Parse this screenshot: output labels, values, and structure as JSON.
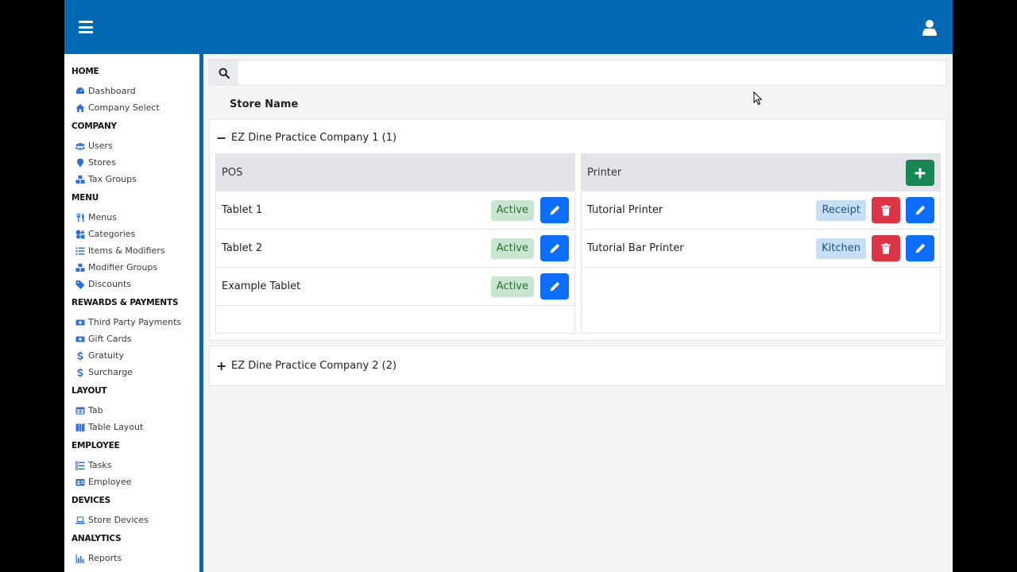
{
  "sidebar": {
    "sections": [
      {
        "title": "HOME",
        "items": [
          {
            "label": "Dashboard",
            "icon": "dashboard-icon"
          },
          {
            "label": "Company Select",
            "icon": "home-icon"
          }
        ]
      },
      {
        "title": "COMPANY",
        "items": [
          {
            "label": "Users",
            "icon": "users-icon"
          },
          {
            "label": "Stores",
            "icon": "map-pin-icon"
          },
          {
            "label": "Tax Groups",
            "icon": "cubes-icon"
          }
        ]
      },
      {
        "title": "MENU",
        "items": [
          {
            "label": "Menus",
            "icon": "utensils-icon"
          },
          {
            "label": "Categories",
            "icon": "shapes-icon"
          },
          {
            "label": "Items & Modifiers",
            "icon": "list-icon"
          },
          {
            "label": "Modifier Groups",
            "icon": "cubes-icon"
          },
          {
            "label": "Discounts",
            "icon": "tags-icon"
          }
        ]
      },
      {
        "title": "REWARDS & PAYMENTS",
        "items": [
          {
            "label": "Third Party Payments",
            "icon": "money-bill-icon"
          },
          {
            "label": "Gift Cards",
            "icon": "money-bill-icon"
          },
          {
            "label": "Gratuity",
            "icon": "dollar-icon"
          },
          {
            "label": "Surcharge",
            "icon": "dollar-icon"
          }
        ]
      },
      {
        "title": "LAYOUT",
        "items": [
          {
            "label": "Tab",
            "icon": "table-icon"
          },
          {
            "label": "Table Layout",
            "icon": "map-icon"
          }
        ]
      },
      {
        "title": "EMPLOYEE",
        "items": [
          {
            "label": "Tasks",
            "icon": "tasks-icon"
          },
          {
            "label": "Employee",
            "icon": "id-card-icon"
          }
        ]
      },
      {
        "title": "DEVICES",
        "items": [
          {
            "label": "Store Devices",
            "icon": "laptop-icon"
          }
        ]
      },
      {
        "title": "ANALYTICS",
        "items": [
          {
            "label": "Reports",
            "icon": "chart-icon"
          }
        ]
      }
    ]
  },
  "search": {
    "placeholder": "",
    "value": ""
  },
  "table": {
    "column_header": "Store Name"
  },
  "companies": [
    {
      "name": "EZ Dine Practice Company 1 (1)",
      "expanded": true,
      "toggle": "−"
    },
    {
      "name": "EZ Dine Practice Company 2 (2)",
      "expanded": false,
      "toggle": "+"
    }
  ],
  "pos_panel": {
    "title": "POS",
    "rows": [
      {
        "label": "Tablet 1",
        "status": "Active"
      },
      {
        "label": "Tablet 2",
        "status": "Active"
      },
      {
        "label": "Example Tablet",
        "status": "Active"
      }
    ]
  },
  "printer_panel": {
    "title": "Printer",
    "rows": [
      {
        "label": "Tutorial Printer",
        "type": "Receipt"
      },
      {
        "label": "Tutorial Bar Printer",
        "type": "Kitchen"
      }
    ]
  },
  "colors": {
    "topbar": "#0069b4",
    "primary": "#0d6efd",
    "danger": "#dc3545",
    "success": "#198754"
  }
}
